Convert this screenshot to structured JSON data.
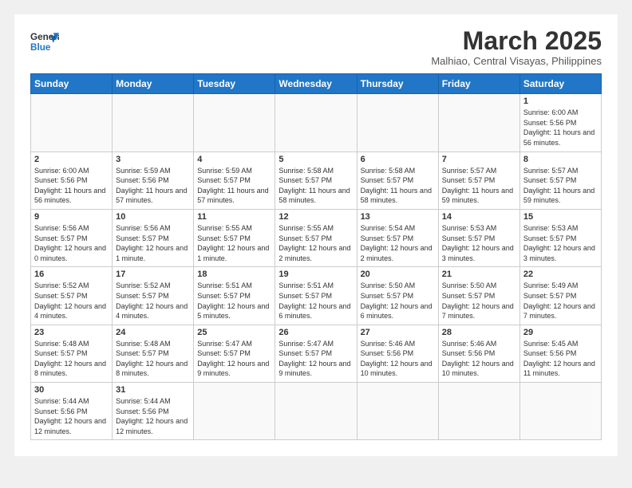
{
  "header": {
    "logo_general": "General",
    "logo_blue": "Blue",
    "month_title": "March 2025",
    "location": "Malhiao, Central Visayas, Philippines"
  },
  "weekdays": [
    "Sunday",
    "Monday",
    "Tuesday",
    "Wednesday",
    "Thursday",
    "Friday",
    "Saturday"
  ],
  "weeks": [
    [
      {
        "day": "",
        "info": ""
      },
      {
        "day": "",
        "info": ""
      },
      {
        "day": "",
        "info": ""
      },
      {
        "day": "",
        "info": ""
      },
      {
        "day": "",
        "info": ""
      },
      {
        "day": "",
        "info": ""
      },
      {
        "day": "1",
        "info": "Sunrise: 6:00 AM\nSunset: 5:56 PM\nDaylight: 11 hours\nand 56 minutes."
      }
    ],
    [
      {
        "day": "2",
        "info": "Sunrise: 6:00 AM\nSunset: 5:56 PM\nDaylight: 11 hours\nand 56 minutes."
      },
      {
        "day": "3",
        "info": "Sunrise: 5:59 AM\nSunset: 5:56 PM\nDaylight: 11 hours\nand 57 minutes."
      },
      {
        "day": "4",
        "info": "Sunrise: 5:59 AM\nSunset: 5:57 PM\nDaylight: 11 hours\nand 57 minutes."
      },
      {
        "day": "5",
        "info": "Sunrise: 5:58 AM\nSunset: 5:57 PM\nDaylight: 11 hours\nand 58 minutes."
      },
      {
        "day": "6",
        "info": "Sunrise: 5:58 AM\nSunset: 5:57 PM\nDaylight: 11 hours\nand 58 minutes."
      },
      {
        "day": "7",
        "info": "Sunrise: 5:57 AM\nSunset: 5:57 PM\nDaylight: 11 hours\nand 59 minutes."
      },
      {
        "day": "8",
        "info": "Sunrise: 5:57 AM\nSunset: 5:57 PM\nDaylight: 11 hours\nand 59 minutes."
      }
    ],
    [
      {
        "day": "9",
        "info": "Sunrise: 5:56 AM\nSunset: 5:57 PM\nDaylight: 12 hours\nand 0 minutes."
      },
      {
        "day": "10",
        "info": "Sunrise: 5:56 AM\nSunset: 5:57 PM\nDaylight: 12 hours\nand 1 minute."
      },
      {
        "day": "11",
        "info": "Sunrise: 5:55 AM\nSunset: 5:57 PM\nDaylight: 12 hours\nand 1 minute."
      },
      {
        "day": "12",
        "info": "Sunrise: 5:55 AM\nSunset: 5:57 PM\nDaylight: 12 hours\nand 2 minutes."
      },
      {
        "day": "13",
        "info": "Sunrise: 5:54 AM\nSunset: 5:57 PM\nDaylight: 12 hours\nand 2 minutes."
      },
      {
        "day": "14",
        "info": "Sunrise: 5:53 AM\nSunset: 5:57 PM\nDaylight: 12 hours\nand 3 minutes."
      },
      {
        "day": "15",
        "info": "Sunrise: 5:53 AM\nSunset: 5:57 PM\nDaylight: 12 hours\nand 3 minutes."
      }
    ],
    [
      {
        "day": "16",
        "info": "Sunrise: 5:52 AM\nSunset: 5:57 PM\nDaylight: 12 hours\nand 4 minutes."
      },
      {
        "day": "17",
        "info": "Sunrise: 5:52 AM\nSunset: 5:57 PM\nDaylight: 12 hours\nand 4 minutes."
      },
      {
        "day": "18",
        "info": "Sunrise: 5:51 AM\nSunset: 5:57 PM\nDaylight: 12 hours\nand 5 minutes."
      },
      {
        "day": "19",
        "info": "Sunrise: 5:51 AM\nSunset: 5:57 PM\nDaylight: 12 hours\nand 6 minutes."
      },
      {
        "day": "20",
        "info": "Sunrise: 5:50 AM\nSunset: 5:57 PM\nDaylight: 12 hours\nand 6 minutes."
      },
      {
        "day": "21",
        "info": "Sunrise: 5:50 AM\nSunset: 5:57 PM\nDaylight: 12 hours\nand 7 minutes."
      },
      {
        "day": "22",
        "info": "Sunrise: 5:49 AM\nSunset: 5:57 PM\nDaylight: 12 hours\nand 7 minutes."
      }
    ],
    [
      {
        "day": "23",
        "info": "Sunrise: 5:48 AM\nSunset: 5:57 PM\nDaylight: 12 hours\nand 8 minutes."
      },
      {
        "day": "24",
        "info": "Sunrise: 5:48 AM\nSunset: 5:57 PM\nDaylight: 12 hours\nand 8 minutes."
      },
      {
        "day": "25",
        "info": "Sunrise: 5:47 AM\nSunset: 5:57 PM\nDaylight: 12 hours\nand 9 minutes."
      },
      {
        "day": "26",
        "info": "Sunrise: 5:47 AM\nSunset: 5:57 PM\nDaylight: 12 hours\nand 9 minutes."
      },
      {
        "day": "27",
        "info": "Sunrise: 5:46 AM\nSunset: 5:56 PM\nDaylight: 12 hours\nand 10 minutes."
      },
      {
        "day": "28",
        "info": "Sunrise: 5:46 AM\nSunset: 5:56 PM\nDaylight: 12 hours\nand 10 minutes."
      },
      {
        "day": "29",
        "info": "Sunrise: 5:45 AM\nSunset: 5:56 PM\nDaylight: 12 hours\nand 11 minutes."
      }
    ],
    [
      {
        "day": "30",
        "info": "Sunrise: 5:44 AM\nSunset: 5:56 PM\nDaylight: 12 hours\nand 12 minutes."
      },
      {
        "day": "31",
        "info": "Sunrise: 5:44 AM\nSunset: 5:56 PM\nDaylight: 12 hours\nand 12 minutes."
      },
      {
        "day": "",
        "info": ""
      },
      {
        "day": "",
        "info": ""
      },
      {
        "day": "",
        "info": ""
      },
      {
        "day": "",
        "info": ""
      },
      {
        "day": "",
        "info": ""
      }
    ]
  ]
}
